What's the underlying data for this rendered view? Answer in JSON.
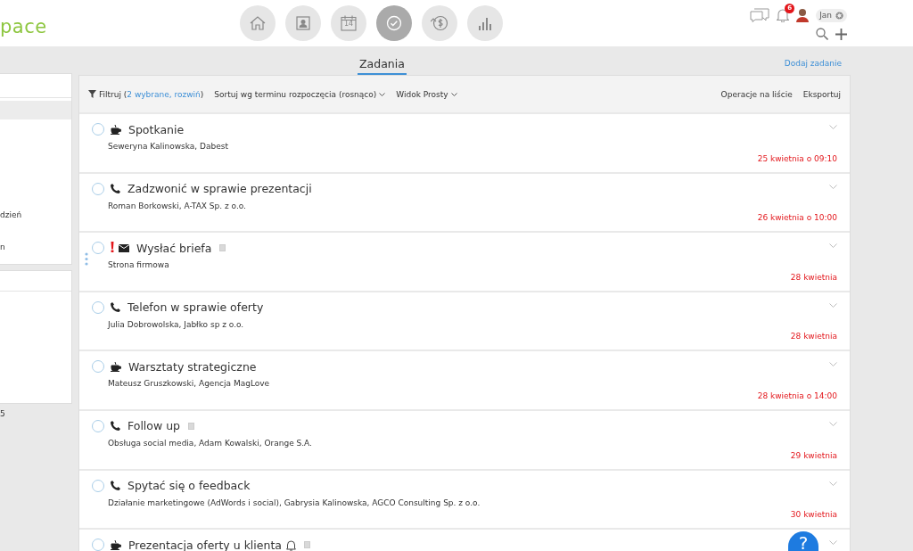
{
  "logo": "pace",
  "nav": [
    {
      "kind": "home",
      "selected": false
    },
    {
      "kind": "contacts",
      "selected": false
    },
    {
      "kind": "calendar",
      "label": "14",
      "selected": false
    },
    {
      "kind": "tasks",
      "selected": true
    },
    {
      "kind": "finance",
      "selected": false
    },
    {
      "kind": "reports",
      "selected": false
    }
  ],
  "user": {
    "notifications": "6",
    "name": "Jan"
  },
  "left_panel": {
    "texts": [
      "dzień",
      "n"
    ],
    "footer": "5"
  },
  "page_title": "Zadania",
  "add_link": "Dodaj zadanie",
  "toolbar": {
    "filter_label": "Filtruj (",
    "filter_link": "2 wybrane, rozwiń",
    "filter_end": ")",
    "sort": "Sortuj wg terminu rozpoczęcia (rosnąco)",
    "view": "Widok Prosty",
    "operations": "Operacje na liście",
    "export": "Eksportuj"
  },
  "tasks": [
    {
      "kind": "meeting",
      "checked": false,
      "title": "Spotkanie",
      "subtitle": "Seweryna Kalinowska, Dabest",
      "date": "25 kwietnia o 09:10",
      "priority": false,
      "note": false,
      "reminder": false,
      "hovered": false
    },
    {
      "kind": "call",
      "checked": false,
      "title": "Zadzwonić w sprawie prezentacji",
      "subtitle": "Roman Borkowski, A-TAX Sp. z o.o.",
      "date": "26 kwietnia o 10:00",
      "priority": false,
      "note": false,
      "reminder": false,
      "hovered": false
    },
    {
      "kind": "email",
      "checked": false,
      "title": "Wysłać briefa",
      "subtitle": "Strona firmowa",
      "date": "28 kwietnia",
      "priority": true,
      "note": true,
      "reminder": false,
      "hovered": true
    },
    {
      "kind": "call",
      "checked": false,
      "title": "Telefon w sprawie oferty",
      "subtitle": "Julia Dobrowolska, Jabłko sp z o.o.",
      "date": "28 kwietnia",
      "priority": false,
      "note": false,
      "reminder": false,
      "hovered": false
    },
    {
      "kind": "meeting",
      "checked": false,
      "title": "Warsztaty strategiczne",
      "subtitle": "Mateusz Gruszkowski, Agencja MagLove",
      "date": "28 kwietnia o 14:00",
      "priority": false,
      "note": false,
      "reminder": false,
      "hovered": false
    },
    {
      "kind": "call",
      "checked": false,
      "title": "Follow up",
      "subtitle": "Obsługa social media, Adam Kowalski, Orange S.A.",
      "date": "29 kwietnia",
      "priority": false,
      "note": true,
      "reminder": false,
      "hovered": false
    },
    {
      "kind": "call",
      "checked": false,
      "title": "Spytać się o feedback",
      "subtitle": "Działanie marketingowe (AdWords i social), Gabrysia Kalinowska, AGCO Consulting Sp. z o.o.",
      "date": "30 kwietnia",
      "priority": false,
      "note": false,
      "reminder": false,
      "hovered": false
    },
    {
      "kind": "meeting",
      "checked": false,
      "title": "Prezentacja oferty u klienta",
      "priority": false,
      "note": true,
      "reminder": true,
      "hovered": false
    }
  ],
  "help": "?"
}
